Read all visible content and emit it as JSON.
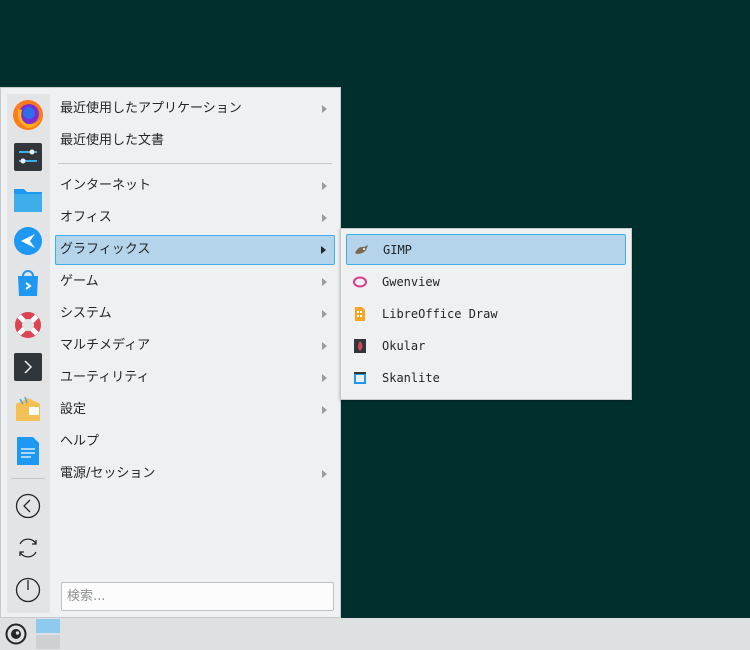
{
  "menu": {
    "categories": [
      {
        "label": "最近使用したアプリケーション",
        "has_submenu": true
      },
      {
        "label": "最近使用した文書",
        "has_submenu": false
      },
      {
        "label": "インターネット",
        "has_submenu": true
      },
      {
        "label": "オフィス",
        "has_submenu": true
      },
      {
        "label": "グラフィックス",
        "has_submenu": true,
        "selected": true
      },
      {
        "label": "ゲーム",
        "has_submenu": true
      },
      {
        "label": "システム",
        "has_submenu": true
      },
      {
        "label": "マルチメディア",
        "has_submenu": true
      },
      {
        "label": "ユーティリティ",
        "has_submenu": true
      },
      {
        "label": "設定",
        "has_submenu": true
      },
      {
        "label": "ヘルプ",
        "has_submenu": false
      },
      {
        "label": "電源/セッション",
        "has_submenu": true
      }
    ],
    "search_placeholder": "検索...",
    "favorites": [
      "firefox-icon",
      "system-settings-icon",
      "file-manager-icon",
      "kde-connect-icon",
      "software-store-icon",
      "help-lifebuoy-icon",
      "terminal-icon",
      "file-manager-package-icon",
      "text-document-icon"
    ],
    "session_actions": [
      "back-icon",
      "restart-icon",
      "power-icon"
    ]
  },
  "submenu": {
    "title": "グラフィックス",
    "apps": [
      {
        "label": "GIMP",
        "icon": "gimp-icon",
        "selected": true
      },
      {
        "label": "Gwenview",
        "icon": "gwenview-icon"
      },
      {
        "label": "LibreOffice Draw",
        "icon": "libreoffice-draw-icon"
      },
      {
        "label": "Okular",
        "icon": "okular-icon"
      },
      {
        "label": "Skanlite",
        "icon": "skanlite-icon"
      }
    ]
  },
  "taskbar": {
    "launcher_icon": "opensuse-icon",
    "pager_icon": "desktop-pager-icon"
  },
  "colors": {
    "desktop": "#00302e",
    "panel": "#eff0f1",
    "selection": "#b3d4ea",
    "selection_border": "#3daee9"
  }
}
